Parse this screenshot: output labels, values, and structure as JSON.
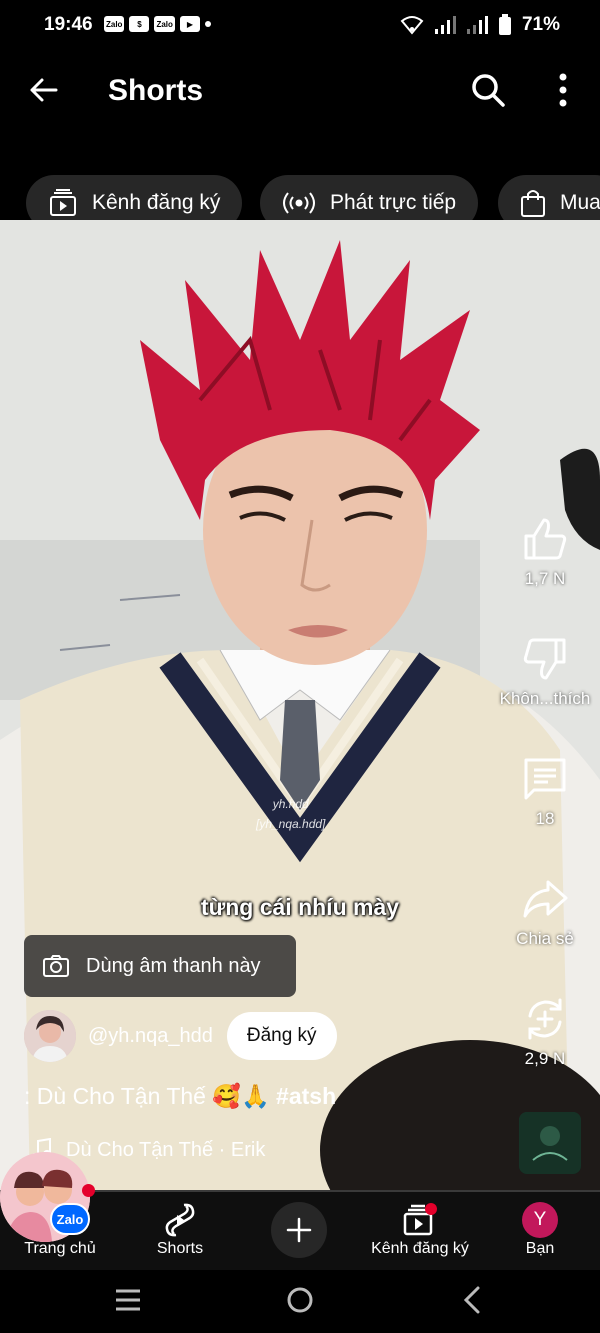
{
  "status": {
    "time": "19:46",
    "app_badges": [
      "Zalo",
      "$",
      "Zalo",
      "▶"
    ],
    "battery": "71%"
  },
  "topbar": {
    "title": "Shorts"
  },
  "chips": [
    {
      "label": "Kênh đăng ký",
      "icon": "subscriptions-icon"
    },
    {
      "label": "Phát trực tiếp",
      "icon": "live-icon"
    },
    {
      "label": "Mua",
      "icon": "shopping-bag-icon"
    }
  ],
  "video": {
    "caption": "từng cái nhíu mày",
    "watermark_1": "yh.hdd",
    "watermark_2": "[yh_nqa.hdd]",
    "use_sound": "Dùng âm thanh này"
  },
  "actions": {
    "like": "1,7 N",
    "dislike": "Khôn...thích",
    "comments": "18",
    "share": "Chia sẻ",
    "remix": "2,9 N"
  },
  "channel": {
    "handle": "@yh.nqa_hdd",
    "subscribe": "Đăng ký"
  },
  "description": {
    "text": ": Dù Cho Tận Thế 🥰🙏",
    "hashtag": "#atsh"
  },
  "music": {
    "track": "Dù Cho Tận Thế · Erik"
  },
  "bottom_nav": {
    "home": "Trang chủ",
    "shorts": "Shorts",
    "subscriptions": "Kênh đăng ký",
    "you": "Bạn",
    "avatar_letter": "Y"
  },
  "zalo": {
    "badge": "Zalo"
  },
  "colors": {
    "background": "#000000",
    "chip": "#272727",
    "accent_red": "#e4002b",
    "zalo_blue": "#0068ff",
    "avatar_pink": "#c2185b"
  }
}
